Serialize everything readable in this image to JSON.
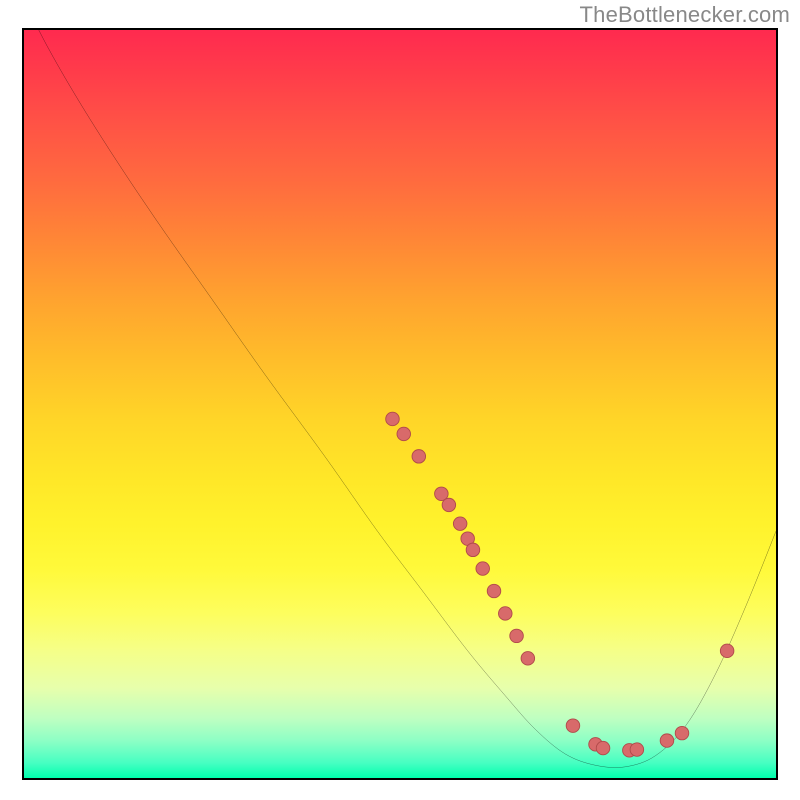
{
  "watermark": "TheBottlenecker.com",
  "colors": {
    "curve": "#000000",
    "marker_fill": "#d86a6a",
    "marker_stroke": "#b04a4a"
  },
  "chart_data": {
    "type": "line",
    "title": "",
    "xlabel": "",
    "ylabel": "",
    "xlim": [
      0,
      100
    ],
    "ylim": [
      0,
      100
    ],
    "note": "x and y are in percent of the plot box; y=0 is top, y=100 is bottom (i.e., lower on the gradient = better/green).",
    "curve": [
      {
        "x": 0.0,
        "y": -4.0
      },
      {
        "x": 3.0,
        "y": 2.0
      },
      {
        "x": 7.0,
        "y": 9.0
      },
      {
        "x": 12.0,
        "y": 17.0
      },
      {
        "x": 18.0,
        "y": 26.0
      },
      {
        "x": 25.0,
        "y": 36.0
      },
      {
        "x": 32.0,
        "y": 46.0
      },
      {
        "x": 40.0,
        "y": 57.0
      },
      {
        "x": 47.0,
        "y": 67.0
      },
      {
        "x": 53.0,
        "y": 75.0
      },
      {
        "x": 59.0,
        "y": 83.0
      },
      {
        "x": 64.0,
        "y": 89.0
      },
      {
        "x": 68.0,
        "y": 93.5
      },
      {
        "x": 72.0,
        "y": 96.8
      },
      {
        "x": 76.0,
        "y": 98.3
      },
      {
        "x": 80.0,
        "y": 98.5
      },
      {
        "x": 84.0,
        "y": 97.0
      },
      {
        "x": 88.0,
        "y": 93.0
      },
      {
        "x": 92.0,
        "y": 86.0
      },
      {
        "x": 96.0,
        "y": 77.0
      },
      {
        "x": 100.0,
        "y": 67.0
      }
    ],
    "markers": [
      {
        "x": 49.0,
        "y": 52.0
      },
      {
        "x": 50.5,
        "y": 54.0
      },
      {
        "x": 52.5,
        "y": 57.0
      },
      {
        "x": 55.5,
        "y": 62.0
      },
      {
        "x": 56.5,
        "y": 63.5
      },
      {
        "x": 58.0,
        "y": 66.0
      },
      {
        "x": 59.0,
        "y": 68.0
      },
      {
        "x": 59.7,
        "y": 69.5
      },
      {
        "x": 61.0,
        "y": 72.0
      },
      {
        "x": 62.5,
        "y": 75.0
      },
      {
        "x": 64.0,
        "y": 78.0
      },
      {
        "x": 65.5,
        "y": 81.0
      },
      {
        "x": 67.0,
        "y": 84.0
      },
      {
        "x": 73.0,
        "y": 93.0
      },
      {
        "x": 76.0,
        "y": 95.5
      },
      {
        "x": 77.0,
        "y": 96.0
      },
      {
        "x": 80.5,
        "y": 96.3
      },
      {
        "x": 81.5,
        "y": 96.2
      },
      {
        "x": 85.5,
        "y": 95.0
      },
      {
        "x": 87.5,
        "y": 94.0
      },
      {
        "x": 93.5,
        "y": 83.0
      }
    ]
  }
}
